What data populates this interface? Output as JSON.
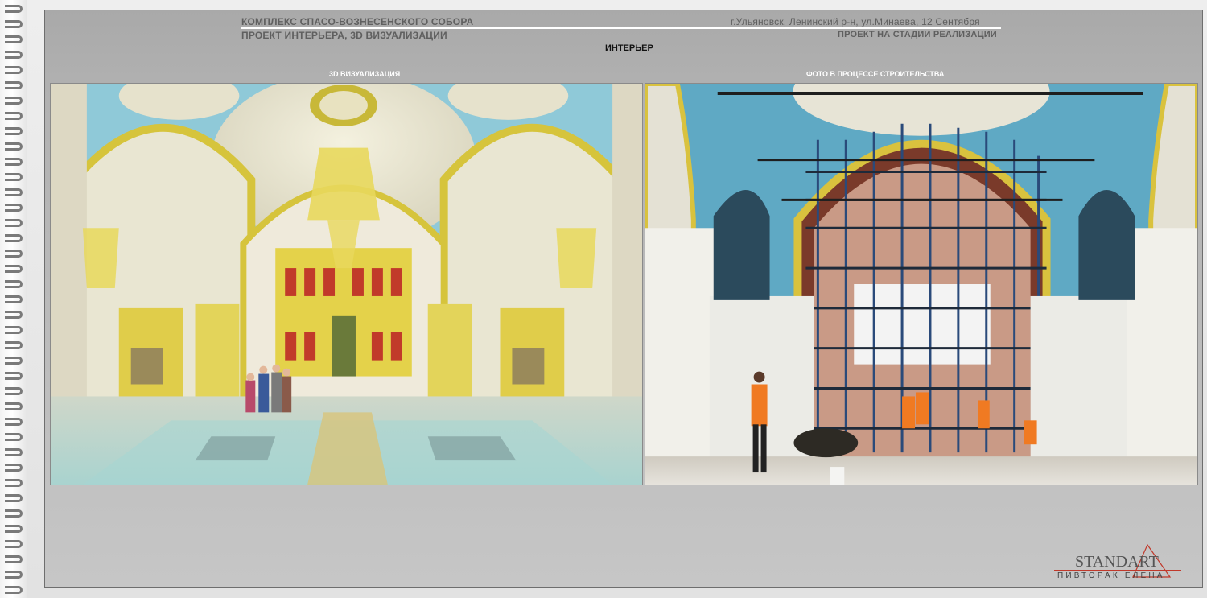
{
  "header": {
    "project_title": "КОМПЛЕКС СПАСО-ВОЗНЕСЕНСКОГО СОБОРА",
    "project_subtitle": "ПРОЕКТ ИНТЕРЬЕРА, 3D ВИЗУАЛИЗАЦИИ",
    "location": "г.Ульяновск, Ленинский р-н, ул.Минаева, 12 Сентября",
    "status": "ПРОЕКТ НА СТАДИИ РЕАЛИЗАЦИИ"
  },
  "section": {
    "title": "ИНТЕРЬЕР"
  },
  "panels": [
    {
      "caption": "3D ВИЗУАЛИЗАЦИЯ",
      "image_icon": "cathedral-render-image"
    },
    {
      "caption": "ФОТО В ПРОЦЕССЕ СТРОИТЕЛЬСТВА",
      "image_icon": "construction-photo-image"
    }
  ],
  "logo": {
    "brand": "STANDART",
    "author": "ПИВТОРАК ЕЛЕНА"
  },
  "colors": {
    "frame": "#b4b4b4",
    "accent": "#c0392b",
    "wall_blue": "#8ec6d6",
    "gold": "#d8c23a"
  }
}
